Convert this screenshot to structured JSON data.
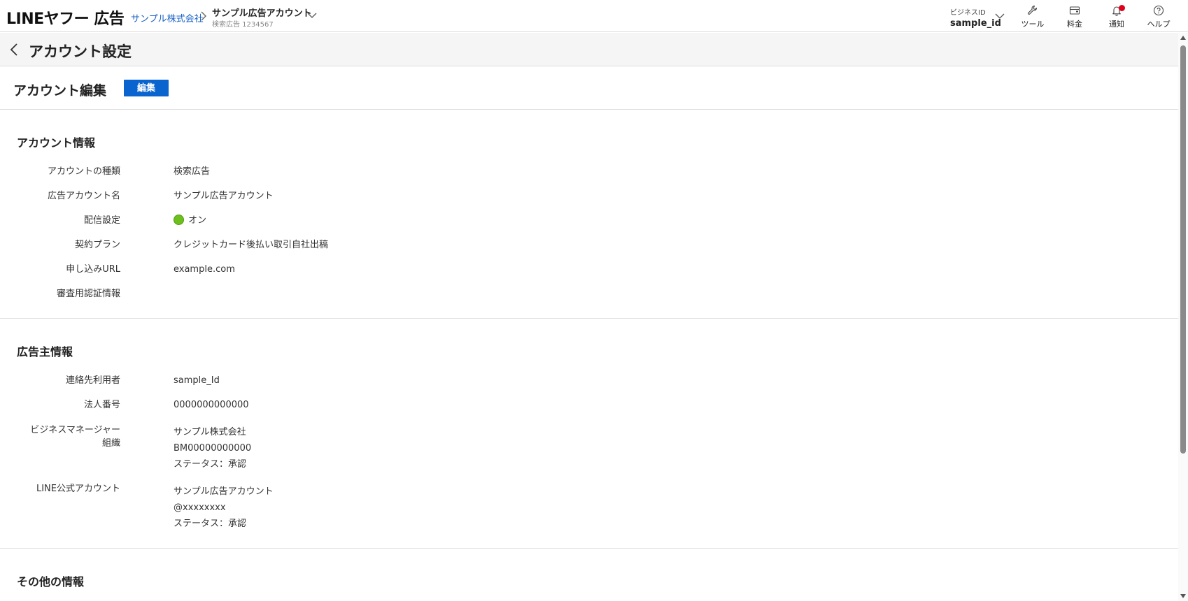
{
  "header": {
    "logo": "LINEヤフー 広告",
    "breadcrumb_company": "サンプル株式会社",
    "account_name": "サンプル広告アカウント",
    "account_sub": "検索広告 1234567",
    "business_id_label": "ビジネスID",
    "business_id_value": "sample_id",
    "nav": {
      "tools": "ツール",
      "billing": "料金",
      "notifications": "通知",
      "help": "ヘルプ"
    },
    "notification_dot_color": "#e0001c"
  },
  "page": {
    "title": "アカウント設定",
    "edit_title": "アカウント編集",
    "edit_button": "編集",
    "accent_color": "#0a64cf"
  },
  "account_info": {
    "title": "アカウント情報",
    "rows": [
      {
        "label": "アカウントの種類",
        "value": "検索広告"
      },
      {
        "label": "広告アカウント名",
        "value": "サンプル広告アカウント"
      },
      {
        "label": "配信設定",
        "value": "オン",
        "status_color": "#6cbf1c"
      },
      {
        "label": "契約プラン",
        "value": "クレジットカード後払い取引自社出稿"
      },
      {
        "label": "申し込みURL",
        "value": "example.com"
      },
      {
        "label": "審査用認証情報",
        "value": ""
      }
    ]
  },
  "advertiser_info": {
    "title": "広告主情報",
    "contact_label": "連絡先利用者",
    "contact_value": "sample_Id",
    "corp_number_label": "法人番号",
    "corp_number_value": "0000000000000",
    "bm_label_1": "ビジネスマネージャー",
    "bm_label_2": "組織",
    "bm_values": [
      "サンプル株式会社",
      "BM00000000000",
      "ステータス：承認"
    ],
    "line_oa_label": "LINE公式アカウント",
    "line_oa_values": [
      "サンプル広告アカウント",
      "@xxxxxxxx",
      "ステータス：承認"
    ]
  },
  "other_info": {
    "title": "その他の情報"
  }
}
